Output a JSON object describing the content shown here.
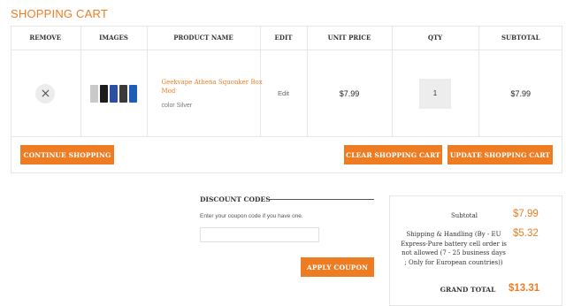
{
  "page_title": "SHOPPING CART",
  "cart": {
    "headers": {
      "remove": "REMOVE",
      "images": "IMAGES",
      "product_name": "PRODUCT NAME",
      "edit": "EDIT",
      "unit_price": "UNIT PRICE",
      "qty": "QTY",
      "subtotal": "SUBTOTAL"
    },
    "item": {
      "remove_icon": "close-icon",
      "name": "Geekvape Athena Squonker Box Mod",
      "attribute": "color Silver",
      "edit_label": "Edit",
      "unit_price": "$7.99",
      "qty": "1",
      "subtotal": "$7.99",
      "image_colors": [
        "#c9c9c9",
        "#1c1c1c",
        "#2a4fa3",
        "#3a3a3a",
        "#1e5db8"
      ]
    }
  },
  "buttons": {
    "continue": "CONTINUE SHOPPING",
    "clear": "CLEAR SHOPPING CART",
    "update": "UPDATE SHOPPING CART",
    "apply_coupon": "APPLY COUPON"
  },
  "discount": {
    "title": "DISCOUNT CODES",
    "hint": "Enter your coupon code if you have one.",
    "value": "",
    "placeholder": ""
  },
  "totals": {
    "subtotal_label": "Subtotal",
    "subtotal_value": "$7.99",
    "shipping_label": "Shipping & Handling (By - EU Express-Pure battery cell order is not allowed (7 - 25 business days ; Only for European countries))",
    "shipping_value": "$5.32",
    "grand_label": "GRAND TOTAL",
    "grand_value": "$13.31"
  },
  "colors": {
    "accent": "#ee7c22",
    "border": "#e6e6e6"
  }
}
